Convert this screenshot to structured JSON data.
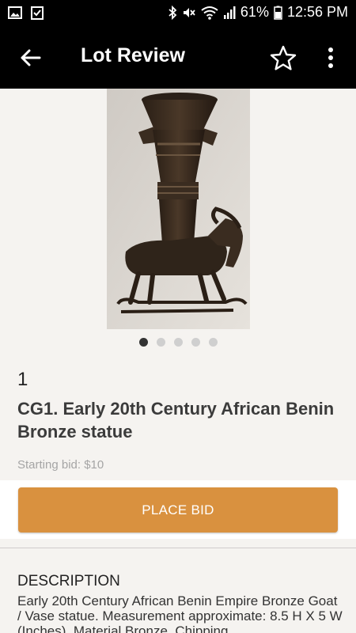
{
  "status": {
    "battery": "61%",
    "time": "12:56 PM"
  },
  "appbar": {
    "title": "Lot Review"
  },
  "carousel": {
    "count": 5,
    "active": 0
  },
  "lot": {
    "number": "1",
    "title": "CG1. Early 20th Century African Benin Bronze statue",
    "starting_bid": "Starting bid: $10"
  },
  "actions": {
    "place_bid": "PLACE BID"
  },
  "description": {
    "heading": "DESCRIPTION",
    "text": "Early 20th Century African Benin Empire Bronze Goat / Vase statue. Measurement approximate: 8.5 H X 5 W (Inches). Material Bronze. Chipping"
  },
  "colors": {
    "accent": "#d9913f",
    "bar": "#000000",
    "background": "#f5f3f0"
  }
}
